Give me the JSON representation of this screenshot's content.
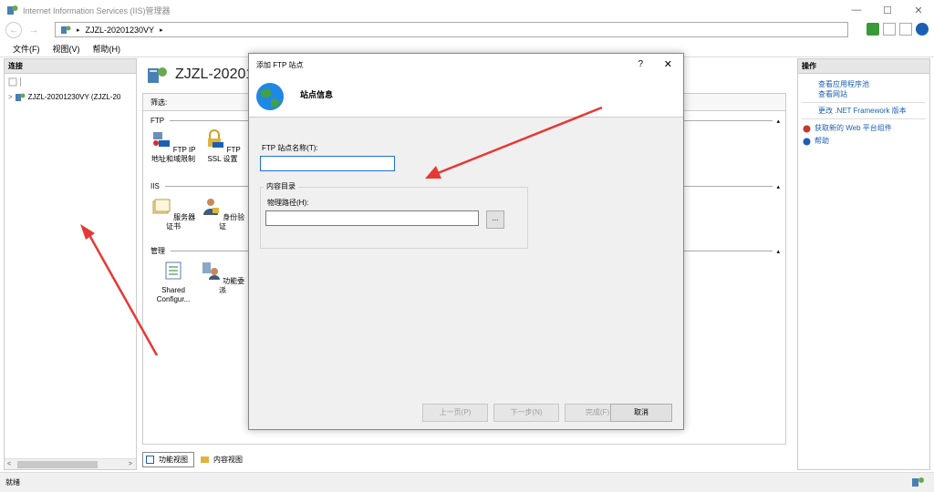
{
  "window": {
    "title": "Internet Information Services (IIS)管理器",
    "controls": {
      "minimize": "—",
      "maximize": "☐",
      "close": "✕"
    }
  },
  "address": {
    "back": "←",
    "forward": "→",
    "path_item": "ZJZL-20201230VY",
    "separator": "▸",
    "trail_arrow": "▸"
  },
  "menu": {
    "file": "文件(F)",
    "view": "视图(V)",
    "help": "帮助(H)"
  },
  "left_pane": {
    "header": "连接",
    "tree_node": "ZJZL-20201230VY (ZJZL-20",
    "expander": ">",
    "scroll_left": "<",
    "scroll_right": ">"
  },
  "center": {
    "title": "ZJZL-20201",
    "filter_label": "筛选:",
    "groups": {
      "ftp": "FTP",
      "iis": "IIS",
      "manage": "管理"
    },
    "collapse_glyph": "▴",
    "features": {
      "ftp_ip": "FTP IP 地址和域限制",
      "ftp_ssl": "FTP SSL 设置",
      "server_cert": "服务器证书",
      "auth": "身份验证",
      "shared_config": "Shared Configur...",
      "delegation": "功能委派"
    },
    "tabs": {
      "features_view": "功能视图",
      "content_view": "内容视图"
    }
  },
  "right_pane": {
    "header": "操作",
    "actions": {
      "view_app_pools": "查看应用程序池",
      "view_sites": "查看网站",
      "change_net": "更改 .NET Framework 版本",
      "get_web_platform": "获取新的 Web 平台组件",
      "help": "帮助"
    }
  },
  "dialog": {
    "title": "添加 FTP 站点",
    "help_glyph": "?",
    "close_glyph": "✕",
    "heading": "站点信息",
    "site_name_label": "FTP 站点名称(T):",
    "site_name_value": "",
    "content_dir_label": "内容目录",
    "physical_path_label": "物理路径(H):",
    "physical_path_value": "",
    "browse_label": "...",
    "buttons": {
      "prev": "上一页(P)",
      "next": "下一步(N)",
      "finish": "完成(F)",
      "cancel": "取消"
    }
  },
  "status": {
    "text": "就绪"
  },
  "colors": {
    "link": "#1a5fb4",
    "annotation_arrow": "#e53935",
    "focus": "#1a73d9"
  }
}
